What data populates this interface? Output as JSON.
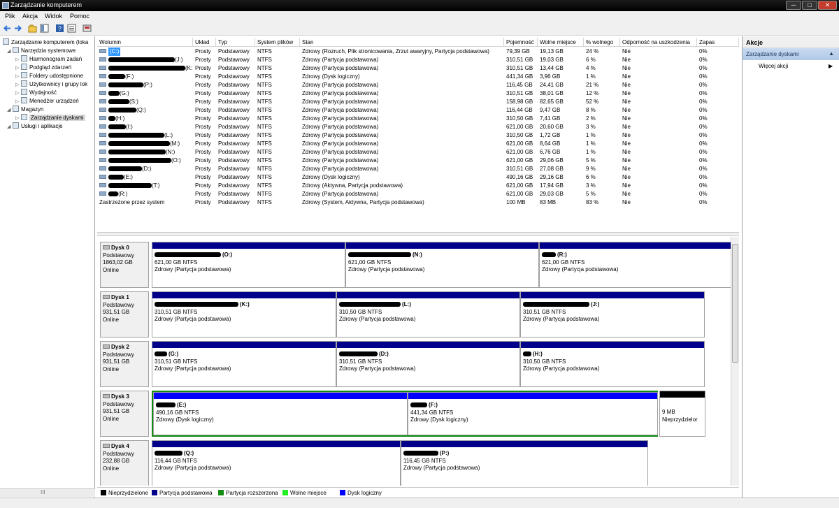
{
  "window": {
    "title": "Zarządzanie komputerem",
    "btn_min": "─",
    "btn_max": "□",
    "btn_close": "✕"
  },
  "menu": [
    "Plik",
    "Akcja",
    "Widok",
    "Pomoc"
  ],
  "tree": [
    {
      "label": "Zarządzanie komputerem (loka",
      "level": 0,
      "icon": "computer-icon"
    },
    {
      "label": "Narzędzia systemowe",
      "level": 1,
      "icon": "tools-icon"
    },
    {
      "label": "Harmonogram zadań",
      "level": 2,
      "icon": "clock-icon"
    },
    {
      "label": "Podgląd zdarzeń",
      "level": 2,
      "icon": "event-viewer-icon"
    },
    {
      "label": "Foldery udostępnione",
      "level": 2,
      "icon": "shared-folder-icon"
    },
    {
      "label": "Użytkownicy i grupy lok",
      "level": 2,
      "icon": "users-icon"
    },
    {
      "label": "Wydajność",
      "level": 2,
      "icon": "performance-icon"
    },
    {
      "label": "Menedżer urządzeń",
      "level": 2,
      "icon": "device-manager-icon"
    },
    {
      "label": "Magazyn",
      "level": 1,
      "icon": "storage-icon"
    },
    {
      "label": "Zarządzanie dyskami",
      "level": 2,
      "icon": "disk-management-icon",
      "selected": true
    },
    {
      "label": "Usługi i aplikacje",
      "level": 1,
      "icon": "services-icon"
    }
  ],
  "tree_scroll_label": "III",
  "volume_columns": [
    "Wolumin",
    "Układ",
    "Typ",
    "System plików",
    "Stan",
    "Pojemność",
    "Wolne miejsce",
    "% wolnego",
    "Odporność na uszkodzenia",
    "Zapas"
  ],
  "volumes": [
    {
      "name": "(C:)",
      "redact": 0,
      "layout": "Prosty",
      "type": "Podstawowy",
      "fs": "NTFS",
      "status": "Zdrowy (Rozruch, Plik stronicowania, Zrzut awaryjny, Partycja podstawowa)",
      "capacity": "79,39 GB",
      "free": "19,13 GB",
      "pct": "24 %",
      "ft": "Nie",
      "ovh": "0%",
      "selected": true
    },
    {
      "name": "(J:)",
      "redact": 95,
      "layout": "Prosty",
      "type": "Podstawowy",
      "fs": "NTFS",
      "status": "Zdrowy (Partycja podstawowa)",
      "capacity": "310,51 GB",
      "free": "19,03 GB",
      "pct": "6 %",
      "ft": "Nie",
      "ovh": "0%"
    },
    {
      "name": "(K:)",
      "redact": 110,
      "layout": "Prosty",
      "type": "Podstawowy",
      "fs": "NTFS",
      "status": "Zdrowy (Partycja podstawowa)",
      "capacity": "310,51 GB",
      "free": "13,44 GB",
      "pct": "4 %",
      "ft": "Nie",
      "ovh": "0%"
    },
    {
      "name": "(F:)",
      "redact": 24,
      "layout": "Prosty",
      "type": "Podstawowy",
      "fs": "NTFS",
      "status": "Zdrowy (Dysk logiczny)",
      "capacity": "441,34 GB",
      "free": "3,96 GB",
      "pct": "1 %",
      "ft": "Nie",
      "ovh": "0%"
    },
    {
      "name": "(P:)",
      "redact": 50,
      "layout": "Prosty",
      "type": "Podstawowy",
      "fs": "NTFS",
      "status": "Zdrowy (Partycja podstawowa)",
      "capacity": "116,45 GB",
      "free": "24,41 GB",
      "pct": "21 %",
      "ft": "Nie",
      "ovh": "0%"
    },
    {
      "name": "(G:)",
      "redact": 16,
      "layout": "Prosty",
      "type": "Podstawowy",
      "fs": "NTFS",
      "status": "Zdrowy (Partycja podstawowa)",
      "capacity": "310,51 GB",
      "free": "38,01 GB",
      "pct": "12 %",
      "ft": "Nie",
      "ovh": "0%"
    },
    {
      "name": "(S:)",
      "redact": 30,
      "layout": "Prosty",
      "type": "Podstawowy",
      "fs": "NTFS",
      "status": "Zdrowy (Partycja podstawowa)",
      "capacity": "158,98 GB",
      "free": "82,65 GB",
      "pct": "52 %",
      "ft": "Nie",
      "ovh": "0%"
    },
    {
      "name": "(Q:)",
      "redact": 40,
      "layout": "Prosty",
      "type": "Podstawowy",
      "fs": "NTFS",
      "status": "Zdrowy (Partycja podstawowa)",
      "capacity": "116,44 GB",
      "free": "9,47 GB",
      "pct": "8 %",
      "ft": "Nie",
      "ovh": "0%"
    },
    {
      "name": "(H:)",
      "redact": 10,
      "layout": "Prosty",
      "type": "Podstawowy",
      "fs": "NTFS",
      "status": "Zdrowy (Partycja podstawowa)",
      "capacity": "310,50 GB",
      "free": "7,41 GB",
      "pct": "2 %",
      "ft": "Nie",
      "ovh": "0%"
    },
    {
      "name": "(I:)",
      "redact": 25,
      "layout": "Prosty",
      "type": "Podstawowy",
      "fs": "NTFS",
      "status": "Zdrowy (Partycja podstawowa)",
      "capacity": "621,00 GB",
      "free": "20,60 GB",
      "pct": "3 %",
      "ft": "Nie",
      "ovh": "0%"
    },
    {
      "name": "(L:)",
      "redact": 80,
      "layout": "Prosty",
      "type": "Podstawowy",
      "fs": "NTFS",
      "status": "Zdrowy (Partycja podstawowa)",
      "capacity": "310,50 GB",
      "free": "1,72 GB",
      "pct": "1 %",
      "ft": "Nie",
      "ovh": "0%"
    },
    {
      "name": "(M:)",
      "redact": 88,
      "layout": "Prosty",
      "type": "Podstawowy",
      "fs": "NTFS",
      "status": "Zdrowy (Partycja podstawowa)",
      "capacity": "621,00 GB",
      "free": "8,64 GB",
      "pct": "1 %",
      "ft": "Nie",
      "ovh": "0%"
    },
    {
      "name": "(N:)",
      "redact": 82,
      "layout": "Prosty",
      "type": "Podstawowy",
      "fs": "NTFS",
      "status": "Zdrowy (Partycja podstawowa)",
      "capacity": "621,00 GB",
      "free": "6,76 GB",
      "pct": "1 %",
      "ft": "Nie",
      "ovh": "0%"
    },
    {
      "name": "(O:)",
      "redact": 90,
      "layout": "Prosty",
      "type": "Podstawowy",
      "fs": "NTFS",
      "status": "Zdrowy (Partycja podstawowa)",
      "capacity": "621,00 GB",
      "free": "29,06 GB",
      "pct": "5 %",
      "ft": "Nie",
      "ovh": "0%"
    },
    {
      "name": "(D:)",
      "redact": 48,
      "layout": "Prosty",
      "type": "Podstawowy",
      "fs": "NTFS",
      "status": "Zdrowy (Partycja podstawowa)",
      "capacity": "310,51 GB",
      "free": "27,08 GB",
      "pct": "9 %",
      "ft": "Nie",
      "ovh": "0%"
    },
    {
      "name": "(E:)",
      "redact": 22,
      "layout": "Prosty",
      "type": "Podstawowy",
      "fs": "NTFS",
      "status": "Zdrowy (Dysk logiczny)",
      "capacity": "490,16 GB",
      "free": "29,16 GB",
      "pct": "6 %",
      "ft": "Nie",
      "ovh": "0%"
    },
    {
      "name": "(T:)",
      "redact": 62,
      "layout": "Prosty",
      "type": "Podstawowy",
      "fs": "NTFS",
      "status": "Zdrowy (Aktywna, Partycja podstawowa)",
      "capacity": "621,00 GB",
      "free": "17,94 GB",
      "pct": "3 %",
      "ft": "Nie",
      "ovh": "0%"
    },
    {
      "name": "(R:)",
      "redact": 14,
      "layout": "Prosty",
      "type": "Podstawowy",
      "fs": "NTFS",
      "status": "Zdrowy (Partycja podstawowa)",
      "capacity": "621,00 GB",
      "free": "29,03 GB",
      "pct": "5 %",
      "ft": "Nie",
      "ovh": "0%"
    },
    {
      "name": "Zastrzeżone przez system",
      "redact": 0,
      "layout": "Prosty",
      "type": "Podstawowy",
      "fs": "NTFS",
      "status": "Zdrowy (System, Aktywna, Partycja podstawowa)",
      "capacity": "100 MB",
      "free": "83 MB",
      "pct": "83 %",
      "ft": "Nie",
      "ovh": "0%",
      "plain": true
    }
  ],
  "disks": [
    {
      "name": "Dysk 0",
      "kind": "Podstawowy",
      "size": "1863,02 GB",
      "state": "Online",
      "partitions": [
        {
          "letter": "(O:)",
          "redact": 95,
          "size": "621,00 GB NTFS",
          "status": "Zdrowy (Partycja podstawowa)",
          "kind": "primary"
        },
        {
          "letter": "(N:)",
          "redact": 90,
          "size": "621,00 GB NTFS",
          "status": "Zdrowy (Partycja podstawowa)",
          "kind": "primary"
        },
        {
          "letter": "(R:)",
          "redact": 20,
          "size": "621,00 GB NTFS",
          "status": "Zdrowy (Partycja podstawowa)",
          "kind": "primary"
        }
      ]
    },
    {
      "name": "Dysk 1",
      "kind": "Podstawowy",
      "size": "931,51 GB",
      "state": "Online",
      "partitions": [
        {
          "letter": "(K:)",
          "redact": 120,
          "size": "310,51 GB NTFS",
          "status": "Zdrowy (Partycja podstawowa)",
          "kind": "primary"
        },
        {
          "letter": "(L:)",
          "redact": 88,
          "size": "310,50 GB NTFS",
          "status": "Zdrowy (Partycja podstawowa)",
          "kind": "primary"
        },
        {
          "letter": "(J:)",
          "redact": 95,
          "size": "310,51 GB NTFS",
          "status": "Zdrowy (Partycja podstawowa)",
          "kind": "primary"
        }
      ]
    },
    {
      "name": "Dysk 2",
      "kind": "Podstawowy",
      "size": "931,51 GB",
      "state": "Online",
      "partitions": [
        {
          "letter": "(G:)",
          "redact": 18,
          "size": "310,51 GB NTFS",
          "status": "Zdrowy (Partycja podstawowa)",
          "kind": "primary"
        },
        {
          "letter": "(D:)",
          "redact": 55,
          "size": "310,51 GB NTFS",
          "status": "Zdrowy (Partycja podstawowa)",
          "kind": "primary"
        },
        {
          "letter": "(H:)",
          "redact": 12,
          "size": "310,50 GB NTFS",
          "status": "Zdrowy (Partycja podstawowa)",
          "kind": "primary"
        }
      ]
    },
    {
      "name": "Dysk 3",
      "kind": "Podstawowy",
      "size": "931,51 GB",
      "state": "Online",
      "partitions": [
        {
          "letter": "(E:)",
          "redact": 28,
          "size": "490,16 GB NTFS",
          "status": "Zdrowy (Dysk logiczny)",
          "kind": "logical"
        },
        {
          "letter": "(F:)",
          "redact": 24,
          "size": "441,34 GB NTFS",
          "status": "Zdrowy (Dysk logiczny)",
          "kind": "logical"
        },
        {
          "letter": "",
          "redact": 0,
          "size": "9 MB",
          "status": "Nieprzydzielor",
          "kind": "unallocated"
        }
      ]
    },
    {
      "name": "Dysk 4",
      "kind": "Podstawowy",
      "size": "232,88 GB",
      "state": "Online",
      "partitions": [
        {
          "letter": "(Q:)",
          "redact": 40,
          "size": "116,44 GB NTFS",
          "status": "Zdrowy (Partycja podstawowa)",
          "kind": "primary"
        },
        {
          "letter": "(P:)",
          "redact": 50,
          "size": "116,45 GB NTFS",
          "status": "Zdrowy (Partycja podstawowa)",
          "kind": "primary"
        }
      ]
    }
  ],
  "legend": [
    {
      "label": "Nieprzydzielone",
      "color": "#000000"
    },
    {
      "label": "Partycja podstawowa",
      "color": "#00008b"
    },
    {
      "label": "Partycja rozszerzona",
      "color": "#138c13"
    },
    {
      "label": "Wolne miejsce",
      "color": "#22ee22"
    },
    {
      "label": "Dysk logiczny",
      "color": "#0000ff"
    }
  ],
  "actions": {
    "header": "Akcje",
    "section": "Zarządzanie dyskami",
    "section_arrow": "▲",
    "more": "Więcej akcji",
    "more_arrow": "▶"
  }
}
